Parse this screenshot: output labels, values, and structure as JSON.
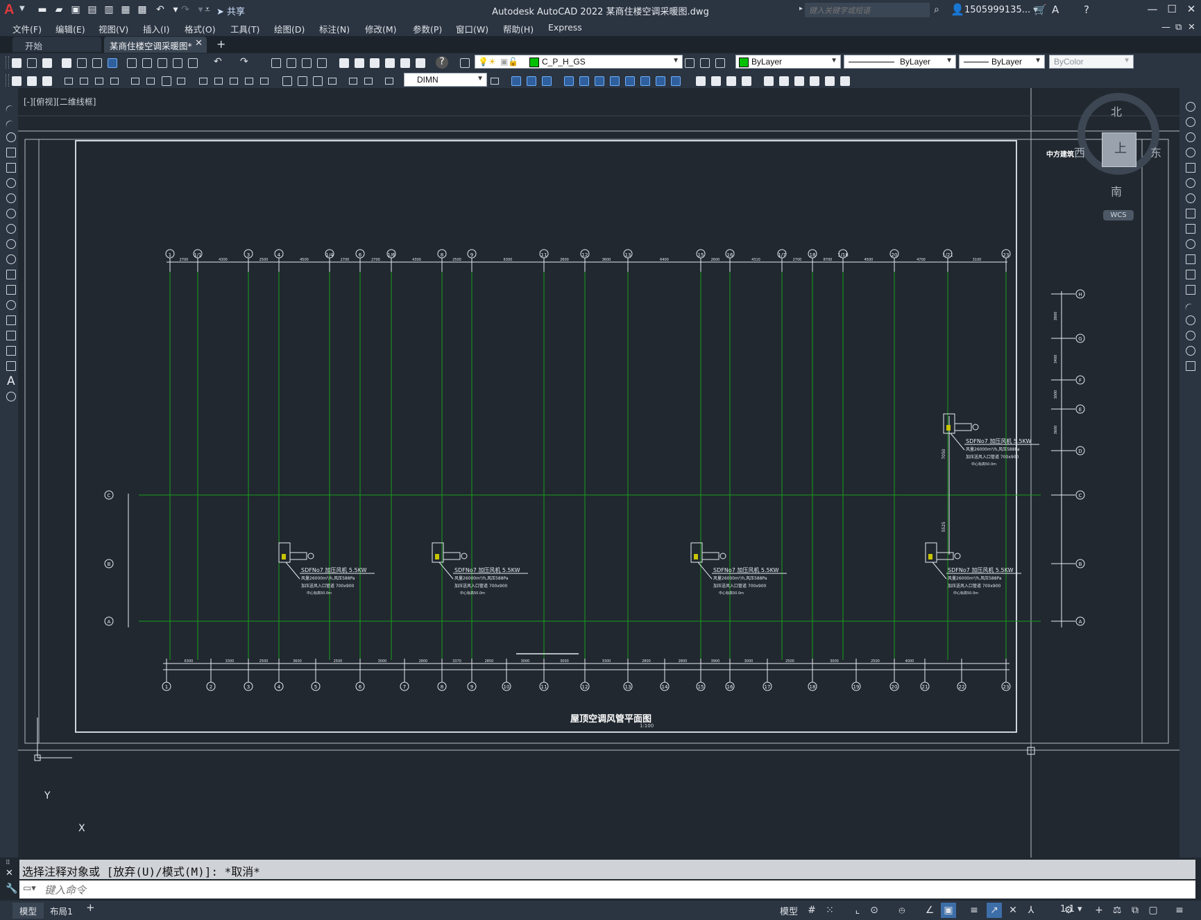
{
  "app": {
    "window_title": "Autodesk AutoCAD 2022    某商住楼空调采暖图.dwg",
    "share_label": "共享",
    "search_placeholder": "键入关键字或短语",
    "user_name": "1505999135... ▾",
    "icons": {
      "logo": "A",
      "share": "➤",
      "search": "⌕",
      "user": "👤",
      "cart": "🛒",
      "a360": "A",
      "help": "?",
      "minimize": "—",
      "restore": "☐",
      "close": "✕"
    }
  },
  "menu": {
    "items": [
      "文件(F)",
      "编辑(E)",
      "视图(V)",
      "插入(I)",
      "格式(O)",
      "工具(T)",
      "绘图(D)",
      "标注(N)",
      "修改(M)",
      "参数(P)",
      "窗口(W)",
      "帮助(H)",
      "Express"
    ],
    "mdi_buttons": [
      "—",
      "⧉",
      "✕"
    ]
  },
  "tabs": {
    "start": "开始",
    "document": "某商住楼空调采暖图*",
    "close": "✕",
    "add": "+"
  },
  "toolbar": {
    "layer_name": "C_P_H_GS",
    "layer_color": "#00c000",
    "color_value": "ByLayer",
    "linetype_value": "ByLayer",
    "lineweight_value": "ByLayer",
    "plotstyle_value": "ByColor",
    "dimstyle_value": "DIMN"
  },
  "viewport": {
    "label": "[-][俯视][二维线框]",
    "viewcube": {
      "north": "北",
      "south": "南",
      "east": "东",
      "west": "西",
      "top_face": "上",
      "wcs": "WCS"
    },
    "ucs": {
      "x": "X",
      "y": "Y"
    }
  },
  "drawing": {
    "plan_title": "屋顶空调风管平面图",
    "plan_scale": "1:100",
    "logo_text": "中方建筑",
    "top_grid_labels": [
      "1",
      "1/1",
      "3",
      "4",
      "1/4",
      "6",
      "1/6",
      "8",
      "9",
      "11",
      "12",
      "13",
      "15",
      "16",
      "1/7",
      "18",
      "1/18",
      "20",
      "1/21",
      "23"
    ],
    "top_dims": [
      "2700",
      "4300",
      "2500",
      "4500",
      "2700",
      "2700",
      "4300",
      "2500",
      "6300",
      "2600",
      "3600",
      "6400",
      "2600",
      "4310",
      "2700",
      "8700",
      "4500",
      "4700",
      "3100"
    ],
    "bottom_grid_labels": [
      "1",
      "2",
      "3",
      "4",
      "5",
      "6",
      "7",
      "8",
      "9",
      "10",
      "11",
      "12",
      "13",
      "14",
      "15",
      "16",
      "17",
      "18",
      "19",
      "20",
      "21",
      "22",
      "23"
    ],
    "bottom_dims": [
      "6300",
      "3300",
      "2500",
      "3600",
      "2500",
      "3000",
      "2800",
      "3370",
      "2850",
      "3000",
      "3000",
      "3300",
      "2800",
      "2800",
      "3900",
      "3000",
      "2500",
      "3000",
      "2500",
      "4000"
    ],
    "left_axis_labels": [
      "C",
      "B",
      "A"
    ],
    "right_axis_labels": [
      "H",
      "G",
      "F",
      "E",
      "D",
      "C",
      "B",
      "A"
    ],
    "right_dims": [
      "3800",
      "3400",
      "3000",
      "3600"
    ],
    "right_vertical_dims": [
      "7050",
      "5525"
    ],
    "fan_label_line1": "SDFNo7 加压风机 5.5KW",
    "fan_label_line2": "风量26000m³/h,风压588Pa",
    "fan_label_line3": "加压送风入口管道 700x900",
    "fan_label_line4": "中心标高50.0m"
  },
  "command": {
    "history": "选择注释对象或 [放弃(U)/模式(M)]: *取消*",
    "input_placeholder": "键入命令",
    "close_icon": "✕",
    "wrench_icon": "🔧",
    "prompt_icon": "▭▾"
  },
  "status": {
    "layout_model": "模型",
    "layout_1": "布局1",
    "add": "+",
    "model_label": "模型",
    "scale": "1:1 ▾",
    "buttons": [
      "#",
      "⁙",
      "⌞",
      "⊙",
      "⦺",
      "∠",
      "▣",
      "≡",
      "↗",
      "✕",
      "⅄",
      "⚙",
      "+",
      "⚖",
      "⧉",
      "▢",
      "≡"
    ]
  }
}
